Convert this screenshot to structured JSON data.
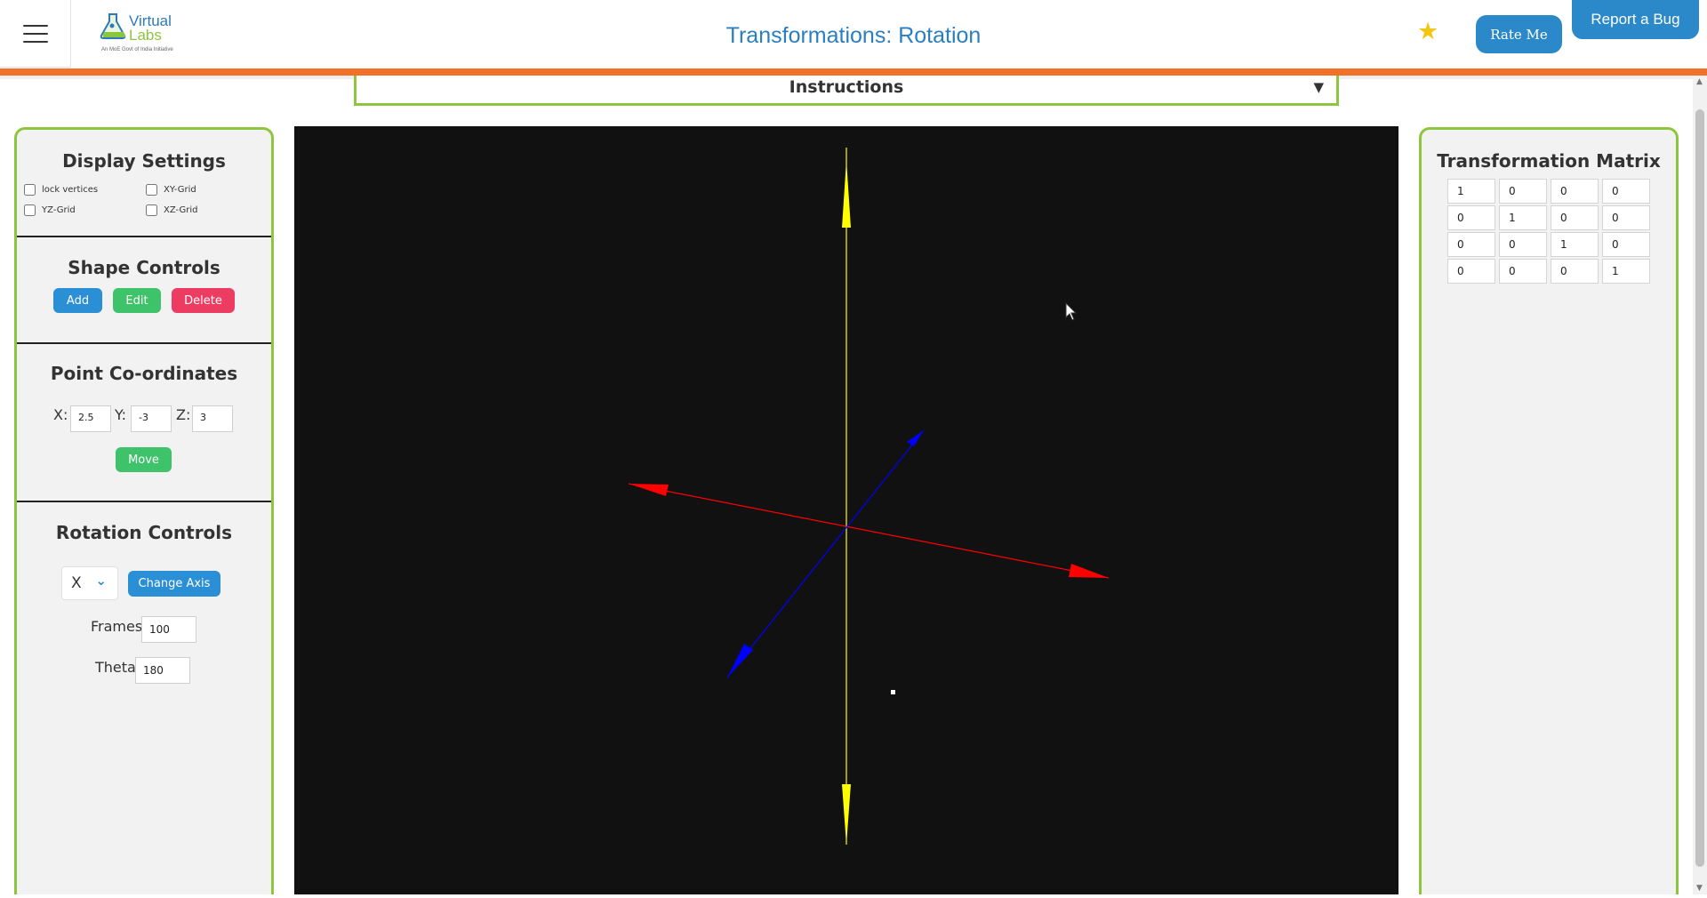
{
  "header": {
    "logo_title_line1": "Virtual",
    "logo_title_line2": "Labs",
    "logo_subtitle": "An MoE Govt of India Initiative",
    "title": "Transformations: Rotation",
    "rate_label": "Rate Me",
    "bug_label": "Report a Bug",
    "star_glyph": "★"
  },
  "instructions": {
    "label": "Instructions",
    "arrow": "▼"
  },
  "display_settings": {
    "title": "Display Settings",
    "options": [
      "lock vertices",
      "XY-Grid",
      "YZ-Grid",
      "XZ-Grid"
    ]
  },
  "shape_controls": {
    "title": "Shape Controls",
    "add_label": "Add",
    "edit_label": "Edit",
    "delete_label": "Delete"
  },
  "point_coordinates": {
    "title": "Point Co-ordinates",
    "x_label": "X:",
    "y_label": "Y:",
    "z_label": "Z:",
    "x_value": "2.5",
    "y_value": "-3",
    "z_value": "3",
    "move_label": "Move"
  },
  "rotation_controls": {
    "title": "Rotation Controls",
    "axis_selected": "X",
    "change_axis_label": "Change Axis",
    "frames_label": "Frames",
    "frames_value": "100",
    "theta_label": "Theta",
    "theta_value": "180"
  },
  "transformation_matrix": {
    "title": "Transformation Matrix",
    "rows": [
      [
        "1",
        "0",
        "0",
        "0"
      ],
      [
        "0",
        "1",
        "0",
        "0"
      ],
      [
        "0",
        "0",
        "1",
        "0"
      ],
      [
        "0",
        "0",
        "0",
        "1"
      ]
    ]
  },
  "colors": {
    "accent_blue": "#2b89c9",
    "panel_border": "#8cc63f",
    "header_bar": "#f07127",
    "x_axis": "#ff0000",
    "y_axis": "#ffff00",
    "z_axis": "#0000ff",
    "canvas_bg": "#111111"
  }
}
